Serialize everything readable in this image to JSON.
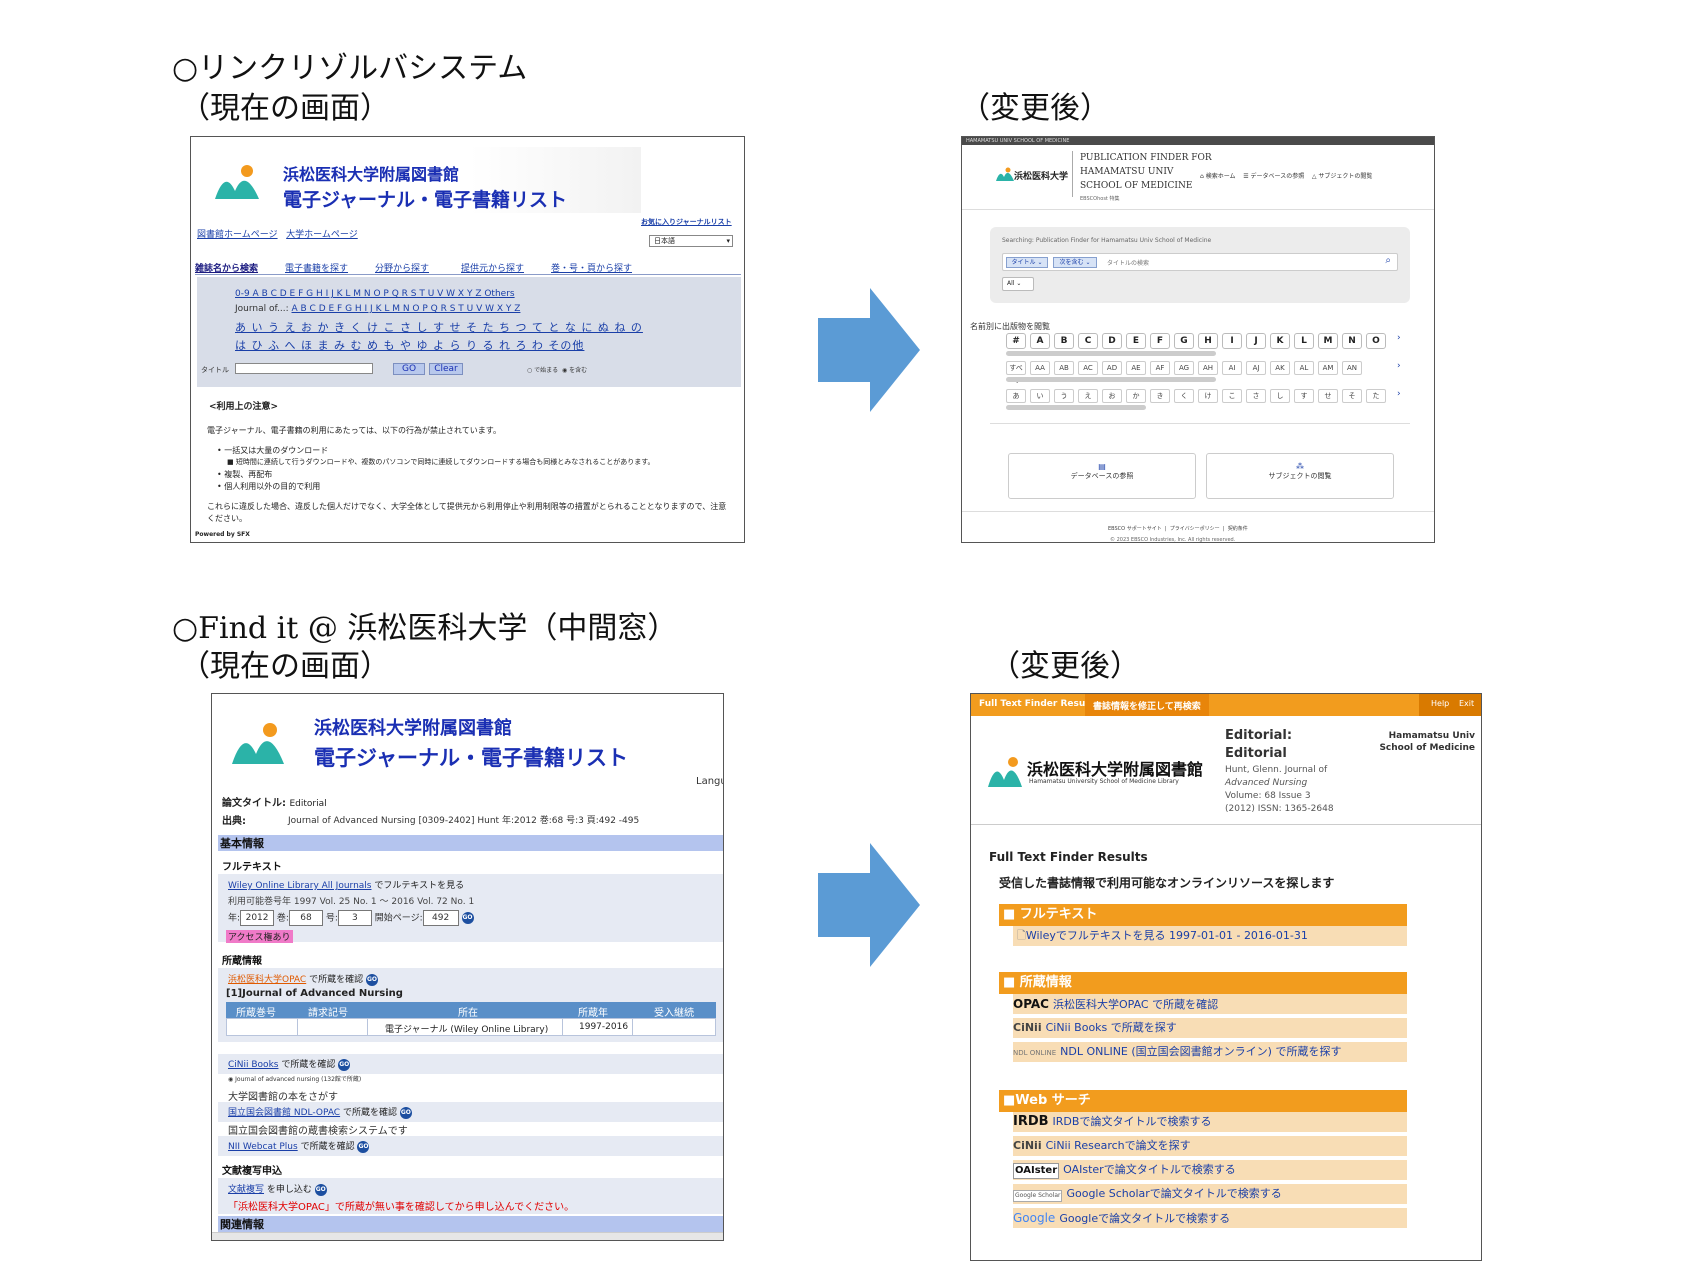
{
  "headings": {
    "link_resolver": "○リンクリゾルバシステム",
    "find_it": "○Find it @ 浜松医科大学（中間窓）",
    "current_screen": "（現在の画面）",
    "after_change": "（変更後）"
  },
  "colors": {
    "arrow": "#5b9bd5",
    "ftf_orange": "#f29c1e",
    "ftf_row": "#f8ddb5",
    "sfx_blue": "#1a2fb3"
  },
  "sfx_list": {
    "library_name": "浜松医科大学附属図書館",
    "list_title": "電子ジャーナル・電子書籍リスト",
    "favorites_link": "お気に入りジャーナルリスト",
    "links": [
      "図書館ホームページ",
      "大学ホームページ"
    ],
    "language": "日本語",
    "tabs": [
      "雑誌名から検索",
      "電子書籍を探す",
      "分野から探す",
      "提供元から探す",
      "巻・号・頁から探す"
    ],
    "alpha_row": "0-9 A B C D E F G H I J K L M N O P Q R S T U V W X Y Z Others",
    "journal_of_label": "Journal of...:",
    "journal_of_row": "A B C D E F G H I J K L M N O P Q R S T U V W X Y Z",
    "kana_row1": "あ い う え お か き く け こ さ し す せ そ た ち つ て と な に ぬ ね の",
    "kana_row2": "は ひ ふ へ ほ ま み む め も や ゆ よ ら り る れ ろ わ その他",
    "title_label": "タイトル",
    "go_button": "GO",
    "clear_button": "Clear",
    "radio_starts": "で始まる",
    "radio_contains": "を含む",
    "notice_heading": "<利用上の注意>",
    "notice_intro": "電子ジャーナル、電子書籍の利用にあたっては、以下の行為が禁止されています。",
    "notice_items": [
      "一括又は大量のダウンロード",
      "短時間に連続して行うダウンロードや、複数のパソコンで同時に連続してダウンロードする場合も同様とみなされることがあります。",
      "複製、再配布",
      "個人利用以外の目的で利用"
    ],
    "notice_footer": "これらに違反した場合、違反した個人だけでなく、大学全体として提供元から利用停止や利用制限等の措置がとられることとなりますので、注意ください。",
    "powered_by": "Powered by SFX"
  },
  "ebsco": {
    "top_bar": "HAMAMATSU UNIV SCHOOL OF MEDICINE",
    "logo_text": "浜松医科大学",
    "title_lines": [
      "PUBLICATION FINDER FOR",
      "HAMAMATSU UNIV",
      "SCHOOL OF MEDICINE"
    ],
    "subtitle": "EBSCOhost 特集",
    "nav": [
      "検索ホーム",
      "データベースの参照",
      "サブジェクトの閲覧"
    ],
    "searching": "Searching: Publication Finder for Hamamatsu Univ School of Medicine",
    "field_select": "タイトル",
    "mode_select": "次を含む",
    "search_placeholder": "タイトルの検索",
    "all_select": "All",
    "browse_heading": "名前別に出版物を閲覧",
    "letters": [
      "#",
      "A",
      "B",
      "C",
      "D",
      "E",
      "F",
      "G",
      "H",
      "I",
      "J",
      "K",
      "L",
      "M",
      "N",
      "O"
    ],
    "letters2": [
      "すべて",
      "AA",
      "AB",
      "AC",
      "AD",
      "AE",
      "AF",
      "AG",
      "AH",
      "AI",
      "AJ",
      "AK",
      "AL",
      "AM",
      "AN"
    ],
    "kana": [
      "あ",
      "い",
      "う",
      "え",
      "お",
      "か",
      "き",
      "く",
      "け",
      "こ",
      "さ",
      "し",
      "す",
      "せ",
      "そ",
      "た"
    ],
    "box_db": "データベースの参照",
    "box_subject": "サブジェクトの閲覧",
    "footer_links": [
      "EBSCO サポートサイト",
      "プライバシーポリシー",
      "契約条件"
    ],
    "copyright": "© 2023 EBSCO Industries, Inc. All rights reserved."
  },
  "findit": {
    "library_name": "浜松医科大学附属図書館",
    "list_title": "電子ジャーナル・電子書籍リスト",
    "language_cut": "Langu",
    "article_title_label": "論文タイトル:",
    "article_title": "Editorial",
    "source_label": "出典:",
    "source": "Journal of Advanced Nursing [0309-2402] Hunt 年:2012 巻:68 号:3 頁:492 -495",
    "basic_info": "基本情報",
    "fulltext_label": "フルテキスト",
    "wiley_link": "Wiley Online Library All Journals",
    "wiley_suffix": " でフルテキストを見る",
    "coverage": "利用可能巻号年  1997 Vol. 25 No. 1 ～ 2016 Vol. 72 No. 1",
    "year_label": "年:",
    "year": "2012",
    "vol_label": "巻:",
    "vol": "68",
    "issue_label": "号:",
    "issue": "3",
    "start_page_label": "開始ページ:",
    "start_page": "492",
    "access_badge": "アクセス権あり",
    "holdings_label": "所蔵情報",
    "opac_link": "浜松医科大学OPAC",
    "opac_suffix": " で所蔵を確認",
    "journal_name": "[1]Journal of Advanced Nursing",
    "table_headers": [
      "所蔵巻号",
      "請求記号",
      "所在",
      "所蔵年",
      "受入継続"
    ],
    "table_row": [
      "",
      "",
      "電子ジャーナル (Wiley Online Library)",
      "1997-2016",
      ""
    ],
    "cinii_link": "CiNii Books",
    "cinii_suffix": " で所蔵を確認",
    "cinii_note": "Journal of advanced nursing (132館で所蔵)",
    "univ_search": "大学図書館の本をさがす",
    "ndl_link": "国立国会図書館 NDL-OPAC",
    "ndl_suffix": " で所蔵を確認",
    "ndl_note": "国立国会図書館の蔵書検索システムです",
    "webcat_link": "NII Webcat Plus",
    "webcat_suffix": " で所蔵を確認",
    "copy_label": "文献複写申込",
    "copy_link": "文献複写",
    "copy_suffix": " を申し込む",
    "warning": "「浜松医科大学OPAC」で所蔵が無い事を確認してから申し込んでください。",
    "related": "関連情報"
  },
  "ftf": {
    "bar_title": "Full Text Finder Results",
    "bar_link": "書誌情報を修正して再検索",
    "help": "Help",
    "exit": "Exit",
    "library_name": "浜松医科大学附属図書館",
    "library_en": "Hamamatsu University School of Medicine Library",
    "article_title1": "Editorial:",
    "article_title2": "Editorial",
    "citation1": "Hunt, Glenn. Journal of",
    "citation2": "Advanced Nursing",
    "citation3": "Volume: 68 Issue 3",
    "citation4": "(2012) ISSN: 1365-2648",
    "institution": "Hamamatsu Univ School of Medicine",
    "results_heading": "Full Text Finder Results",
    "results_sub": "受信した書誌情報で利用可能なオンラインリソースを探します",
    "sec_fulltext": "■ フルテキスト",
    "fulltext_row": "Wileyでフルテキストを見る 1997-01-01 - 2016-01-31",
    "sec_holdings": "■ 所蔵情報",
    "holdings_rows": [
      {
        "logo": "OPAC",
        "text": "浜松医科大学OPAC で所蔵を確認"
      },
      {
        "logo": "CiNii",
        "text": "CiNii Books で所蔵を探す"
      },
      {
        "logo": "NDL ONLINE",
        "text": "NDL ONLINE (国立国会図書館オンライン) で所蔵を探す"
      }
    ],
    "sec_web": "■Web サーチ",
    "web_rows": [
      {
        "logo": "IRDB",
        "text": "IRDBで論文タイトルで検索する"
      },
      {
        "logo": "CiNii",
        "text": "CiNii Researchで論文を探す"
      },
      {
        "logo": "OAIster",
        "text": "OAIsterで論文タイトルで検索する"
      },
      {
        "logo": "Google Scholar",
        "text": "Google Scholarで論文タイトルで検索する"
      },
      {
        "logo": "Google",
        "text": "Googleで論文タイトルで検索する"
      }
    ]
  }
}
